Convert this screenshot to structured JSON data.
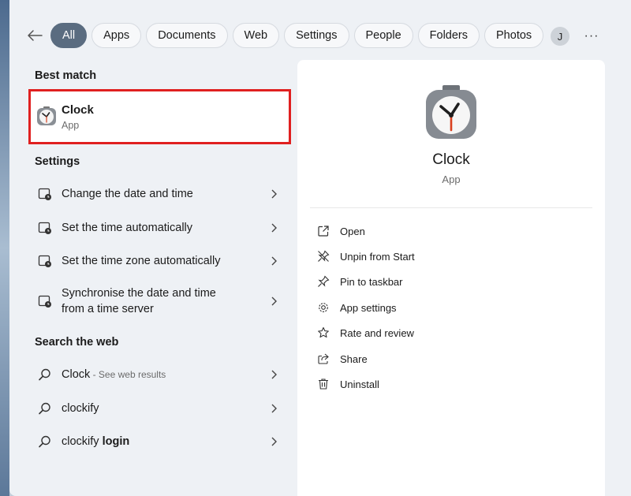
{
  "filters": {
    "back_icon": "back-arrow-icon",
    "chips": [
      "All",
      "Apps",
      "Documents",
      "Web",
      "Settings",
      "People",
      "Folders",
      "Photos"
    ],
    "active_index": 0,
    "more_icon": "play-triangle-icon",
    "avatar_letter": "J",
    "ellipsis": "···"
  },
  "best_match": {
    "heading": "Best match",
    "title": "Clock",
    "subtitle": "App",
    "icon": "clock-app-icon"
  },
  "settings": {
    "heading": "Settings",
    "items": [
      {
        "label": "Change the date and time"
      },
      {
        "label": "Set the time automatically"
      },
      {
        "label": "Set the time zone automatically"
      },
      {
        "label_line1": "Synchronise the date and time",
        "label_line2": "from a time server"
      }
    ]
  },
  "web": {
    "heading": "Search the web",
    "items": [
      {
        "query": "Clock",
        "hint": " - See web results"
      },
      {
        "query": "clockify"
      },
      {
        "query_prefix": "clockify",
        "query_bold": " login"
      }
    ]
  },
  "details": {
    "app_name": "Clock",
    "app_type": "App",
    "actions": [
      {
        "label": "Open",
        "icon": "open-external-icon"
      },
      {
        "label": "Unpin from Start",
        "icon": "unpin-icon"
      },
      {
        "label": "Pin to taskbar",
        "icon": "pin-icon"
      },
      {
        "label": "App settings",
        "icon": "gear-icon"
      },
      {
        "label": "Rate and review",
        "icon": "star-icon"
      },
      {
        "label": "Share",
        "icon": "share-icon"
      },
      {
        "label": "Uninstall",
        "icon": "trash-icon"
      }
    ]
  },
  "colors": {
    "accent": "#5a6c80",
    "highlight": "#e02020",
    "clock_hand": "#d9401e"
  }
}
